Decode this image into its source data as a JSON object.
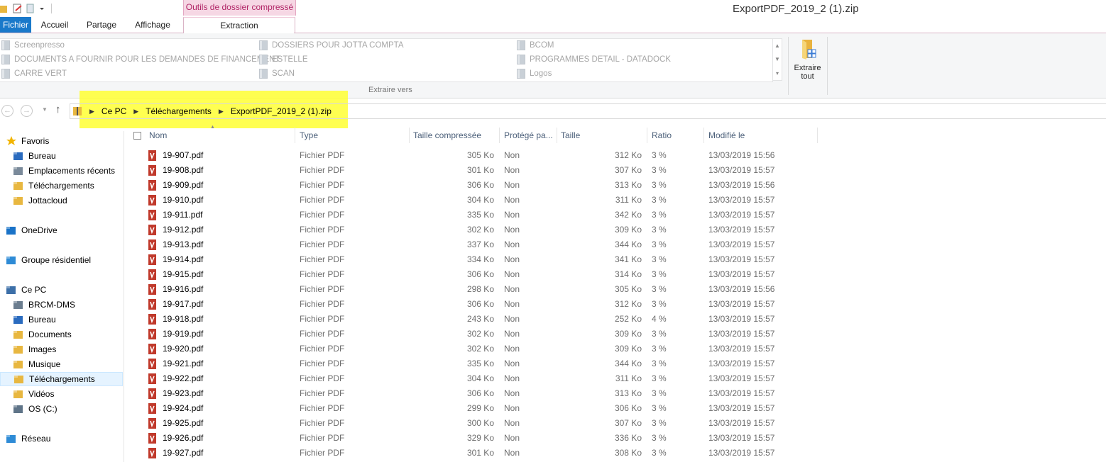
{
  "window": {
    "title": "ExportPDF_2019_2 (1).zip"
  },
  "ribbon": {
    "context_tab_header": "Outils de dossier compressé",
    "tabs": [
      "Fichier",
      "Accueil",
      "Partage",
      "Affichage",
      "Extraction"
    ],
    "destinations": [
      "Screenpresso",
      "DOCUMENTS A FOURNIR POUR LES DEMANDES DE FINANCEMENT",
      "CARRE VERT",
      "DOSSIERS POUR JOTTA COMPTA",
      "ESTELLE",
      "SCAN",
      "BCOM",
      "PROGRAMMES DETAIL - DATADOCK",
      "Logos"
    ],
    "group_label": "Extraire vers",
    "extract_all_line1": "Extraire",
    "extract_all_line2": "tout"
  },
  "addressbar": {
    "breadcrumb": [
      "Ce PC",
      "Téléchargements",
      "ExportPDF_2019_2 (1).zip"
    ]
  },
  "navpane": {
    "items": [
      {
        "label": "Favoris",
        "icon": "star-icon"
      },
      {
        "label": "Bureau",
        "icon": "desktop-icon"
      },
      {
        "label": "Emplacements récents",
        "icon": "recent-places-icon"
      },
      {
        "label": "Téléchargements",
        "icon": "downloads-folder-icon"
      },
      {
        "label": "Jottacloud",
        "icon": "folder-icon"
      },
      {
        "label": "OneDrive",
        "icon": "onedrive-icon"
      },
      {
        "label": "Groupe résidentiel",
        "icon": "homegroup-icon"
      },
      {
        "label": "Ce PC",
        "icon": "computer-icon"
      },
      {
        "label": "BRCM-DMS",
        "icon": "network-drive-icon"
      },
      {
        "label": "Bureau",
        "icon": "desktop-folder-icon"
      },
      {
        "label": "Documents",
        "icon": "documents-folder-icon"
      },
      {
        "label": "Images",
        "icon": "pictures-folder-icon"
      },
      {
        "label": "Musique",
        "icon": "music-folder-icon"
      },
      {
        "label": "Téléchargements",
        "icon": "downloads-folder-icon"
      },
      {
        "label": "Vidéos",
        "icon": "videos-folder-icon"
      },
      {
        "label": "OS (C:)",
        "icon": "drive-icon"
      },
      {
        "label": "Réseau",
        "icon": "network-icon"
      }
    ]
  },
  "columns": [
    "Nom",
    "Type",
    "Taille compressée",
    "Protégé pa...",
    "Taille",
    "Ratio",
    "Modifié le"
  ],
  "files": [
    {
      "name": "19-907.pdf",
      "type": "Fichier PDF",
      "compressed": "305 Ko",
      "protected": "Non",
      "size": "312 Ko",
      "ratio": "3 %",
      "modified": "13/03/2019 15:56"
    },
    {
      "name": "19-908.pdf",
      "type": "Fichier PDF",
      "compressed": "301 Ko",
      "protected": "Non",
      "size": "307 Ko",
      "ratio": "3 %",
      "modified": "13/03/2019 15:57"
    },
    {
      "name": "19-909.pdf",
      "type": "Fichier PDF",
      "compressed": "306 Ko",
      "protected": "Non",
      "size": "313 Ko",
      "ratio": "3 %",
      "modified": "13/03/2019 15:56"
    },
    {
      "name": "19-910.pdf",
      "type": "Fichier PDF",
      "compressed": "304 Ko",
      "protected": "Non",
      "size": "311 Ko",
      "ratio": "3 %",
      "modified": "13/03/2019 15:57"
    },
    {
      "name": "19-911.pdf",
      "type": "Fichier PDF",
      "compressed": "335 Ko",
      "protected": "Non",
      "size": "342 Ko",
      "ratio": "3 %",
      "modified": "13/03/2019 15:57"
    },
    {
      "name": "19-912.pdf",
      "type": "Fichier PDF",
      "compressed": "302 Ko",
      "protected": "Non",
      "size": "309 Ko",
      "ratio": "3 %",
      "modified": "13/03/2019 15:57"
    },
    {
      "name": "19-913.pdf",
      "type": "Fichier PDF",
      "compressed": "337 Ko",
      "protected": "Non",
      "size": "344 Ko",
      "ratio": "3 %",
      "modified": "13/03/2019 15:57"
    },
    {
      "name": "19-914.pdf",
      "type": "Fichier PDF",
      "compressed": "334 Ko",
      "protected": "Non",
      "size": "341 Ko",
      "ratio": "3 %",
      "modified": "13/03/2019 15:57"
    },
    {
      "name": "19-915.pdf",
      "type": "Fichier PDF",
      "compressed": "306 Ko",
      "protected": "Non",
      "size": "314 Ko",
      "ratio": "3 %",
      "modified": "13/03/2019 15:57"
    },
    {
      "name": "19-916.pdf",
      "type": "Fichier PDF",
      "compressed": "298 Ko",
      "protected": "Non",
      "size": "305 Ko",
      "ratio": "3 %",
      "modified": "13/03/2019 15:56"
    },
    {
      "name": "19-917.pdf",
      "type": "Fichier PDF",
      "compressed": "306 Ko",
      "protected": "Non",
      "size": "312 Ko",
      "ratio": "3 %",
      "modified": "13/03/2019 15:57"
    },
    {
      "name": "19-918.pdf",
      "type": "Fichier PDF",
      "compressed": "243 Ko",
      "protected": "Non",
      "size": "252 Ko",
      "ratio": "4 %",
      "modified": "13/03/2019 15:57"
    },
    {
      "name": "19-919.pdf",
      "type": "Fichier PDF",
      "compressed": "302 Ko",
      "protected": "Non",
      "size": "309 Ko",
      "ratio": "3 %",
      "modified": "13/03/2019 15:57"
    },
    {
      "name": "19-920.pdf",
      "type": "Fichier PDF",
      "compressed": "302 Ko",
      "protected": "Non",
      "size": "309 Ko",
      "ratio": "3 %",
      "modified": "13/03/2019 15:57"
    },
    {
      "name": "19-921.pdf",
      "type": "Fichier PDF",
      "compressed": "335 Ko",
      "protected": "Non",
      "size": "344 Ko",
      "ratio": "3 %",
      "modified": "13/03/2019 15:57"
    },
    {
      "name": "19-922.pdf",
      "type": "Fichier PDF",
      "compressed": "304 Ko",
      "protected": "Non",
      "size": "311 Ko",
      "ratio": "3 %",
      "modified": "13/03/2019 15:57"
    },
    {
      "name": "19-923.pdf",
      "type": "Fichier PDF",
      "compressed": "306 Ko",
      "protected": "Non",
      "size": "313 Ko",
      "ratio": "3 %",
      "modified": "13/03/2019 15:57"
    },
    {
      "name": "19-924.pdf",
      "type": "Fichier PDF",
      "compressed": "299 Ko",
      "protected": "Non",
      "size": "306 Ko",
      "ratio": "3 %",
      "modified": "13/03/2019 15:57"
    },
    {
      "name": "19-925.pdf",
      "type": "Fichier PDF",
      "compressed": "300 Ko",
      "protected": "Non",
      "size": "307 Ko",
      "ratio": "3 %",
      "modified": "13/03/2019 15:57"
    },
    {
      "name": "19-926.pdf",
      "type": "Fichier PDF",
      "compressed": "329 Ko",
      "protected": "Non",
      "size": "336 Ko",
      "ratio": "3 %",
      "modified": "13/03/2019 15:57"
    },
    {
      "name": "19-927.pdf",
      "type": "Fichier PDF",
      "compressed": "301 Ko",
      "protected": "Non",
      "size": "308 Ko",
      "ratio": "3 %",
      "modified": "13/03/2019 15:57"
    }
  ],
  "colors": {
    "accent": "#1979ca",
    "context_tab": "#b12667",
    "highlight": "#ffff33",
    "pdf_icon": "#c0392b"
  }
}
